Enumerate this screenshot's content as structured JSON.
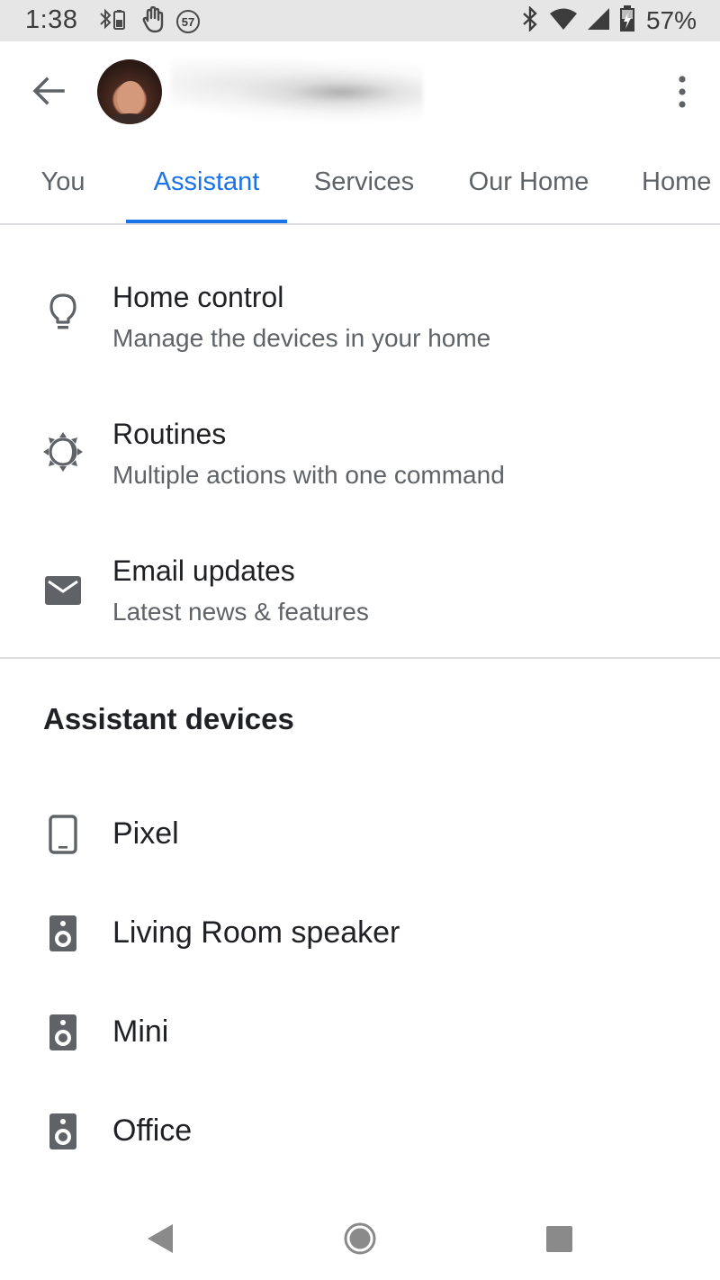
{
  "status_bar": {
    "time": "1:38",
    "notification_badge": "57",
    "battery_percent": "57%",
    "icons": [
      "bluetooth-battery-icon",
      "hand-icon",
      "notification-count-icon",
      "bluetooth-icon",
      "wifi-icon",
      "signal-icon",
      "battery-charging-icon"
    ]
  },
  "header": {
    "back_icon": "arrow-back-icon",
    "avatar": "profile-avatar",
    "overflow_icon": "more-vert-icon"
  },
  "tabs": [
    {
      "label": "You",
      "active": false
    },
    {
      "label": "Assistant",
      "active": true
    },
    {
      "label": "Services",
      "active": false
    },
    {
      "label": "Our Home",
      "active": false
    },
    {
      "label": "Home",
      "active": false
    }
  ],
  "settings_items": [
    {
      "title": "Home control",
      "subtitle": "Manage the devices in your home",
      "icon": "lightbulb-icon"
    },
    {
      "title": "Routines",
      "subtitle": "Multiple actions with one command",
      "icon": "routines-icon"
    },
    {
      "title": "Email updates",
      "subtitle": "Latest news & features",
      "icon": "email-icon"
    }
  ],
  "devices_section": {
    "heading": "Assistant devices",
    "devices": [
      {
        "label": "Pixel",
        "icon": "phone-icon"
      },
      {
        "label": "Living Room speaker",
        "icon": "speaker-icon"
      },
      {
        "label": "Mini",
        "icon": "speaker-icon"
      },
      {
        "label": "Office",
        "icon": "speaker-icon"
      }
    ]
  },
  "colors": {
    "accent": "#1a73e8",
    "text_primary": "#202124",
    "text_secondary": "#5f6368",
    "icon": "#5f6368",
    "divider": "#dadce0",
    "status_bar_bg": "#e6e6e6"
  }
}
